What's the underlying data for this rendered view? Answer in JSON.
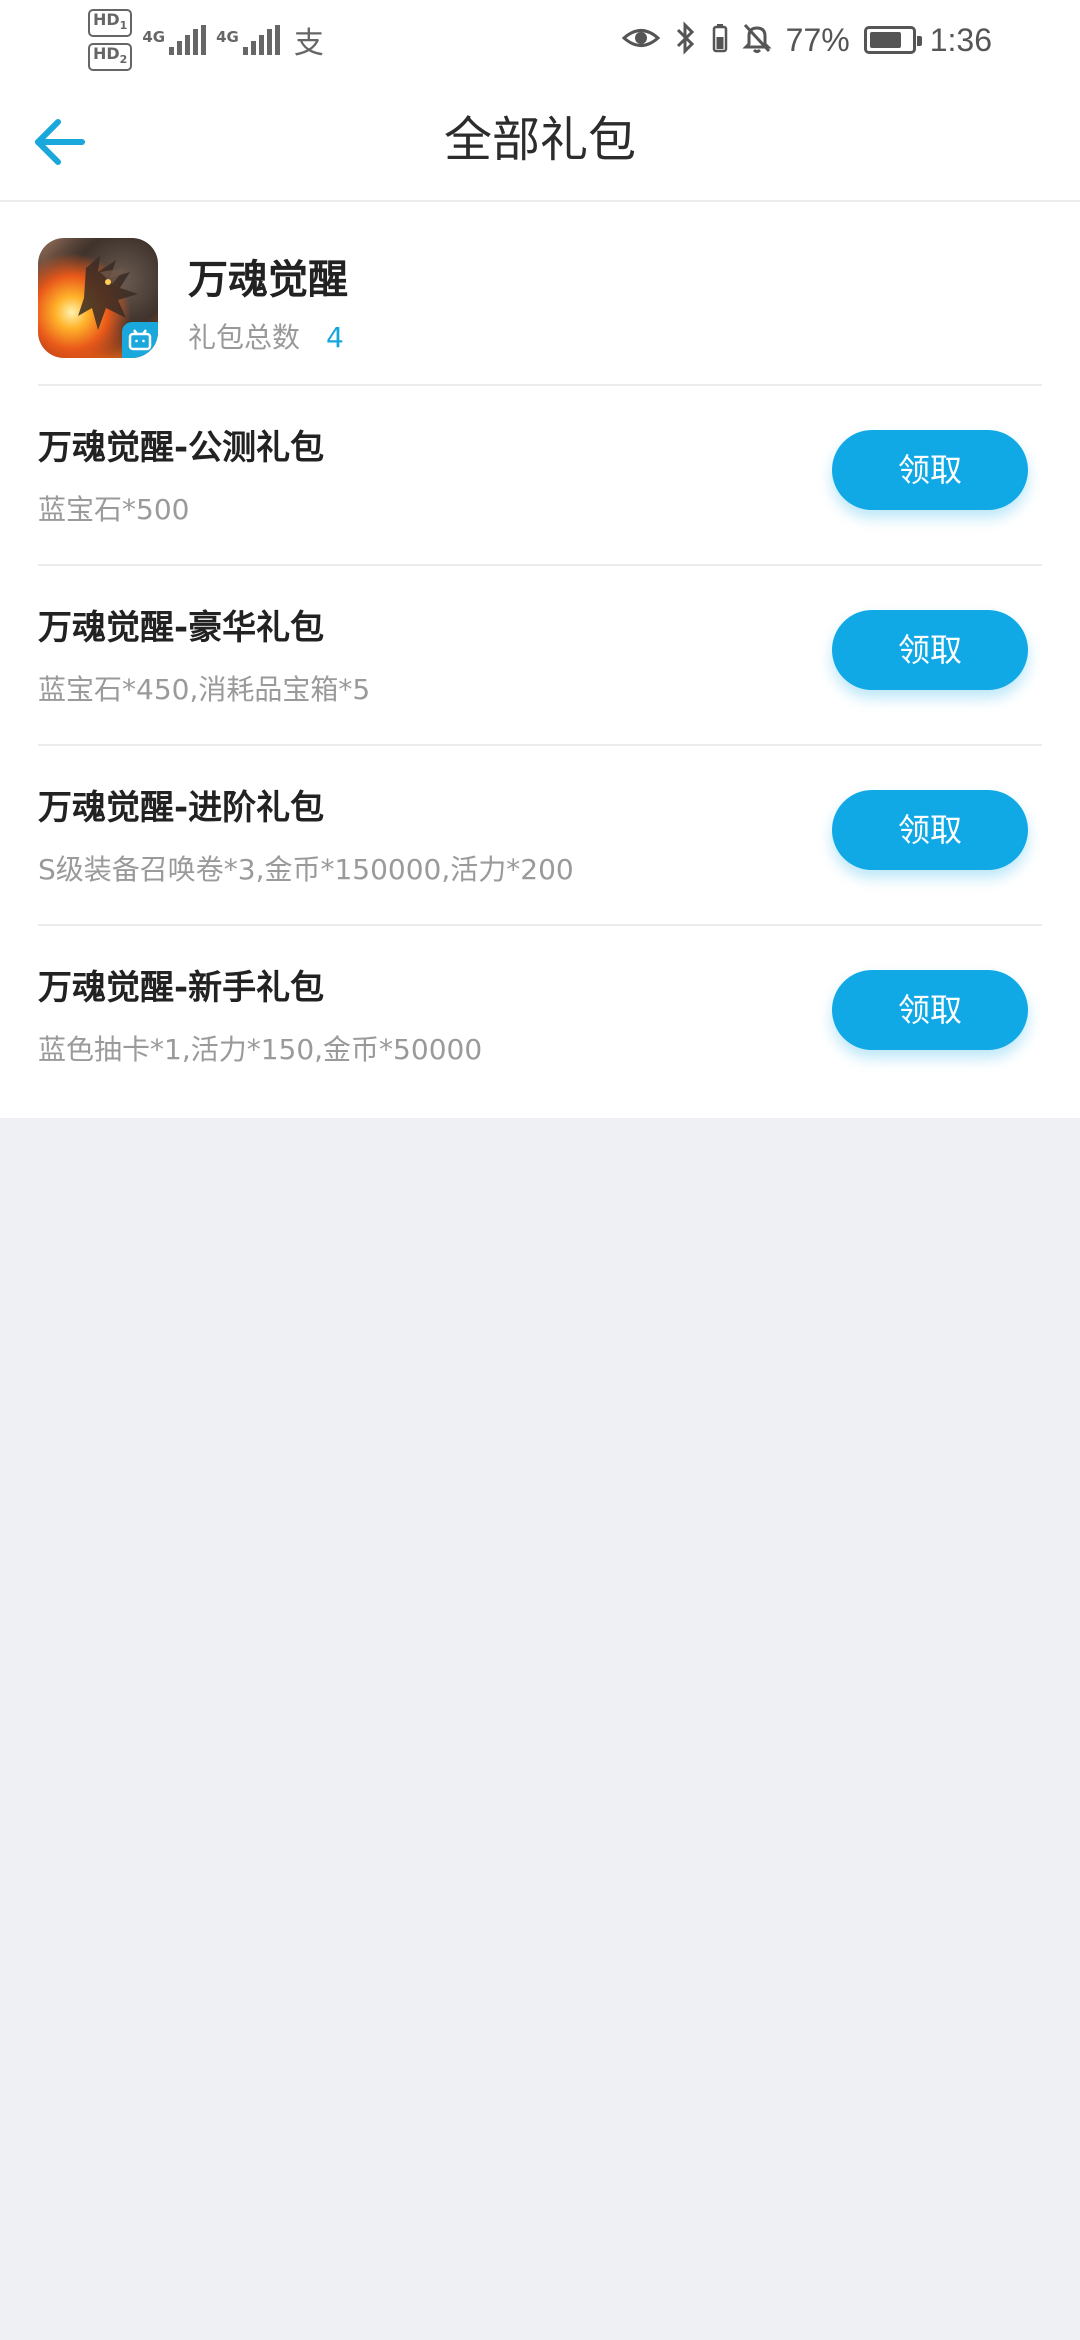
{
  "status_bar": {
    "hd1": "HD",
    "hd1_sub": "1",
    "hd2": "HD",
    "hd2_sub": "2",
    "net1": "4G",
    "net2": "4G",
    "alipay_glyph": "支",
    "battery_percent": "77%",
    "battery_level": 0.77,
    "time": "1:36",
    "icons": [
      "eye-icon",
      "bluetooth-icon",
      "bell-off-icon",
      "battery-icon"
    ]
  },
  "header": {
    "title": "全部礼包",
    "back_icon": "arrow-left-icon"
  },
  "game": {
    "name": "万魂觉醒",
    "gift_total_label": "礼包总数",
    "gift_total_count": "4"
  },
  "gifts": [
    {
      "title": "万魂觉醒-公测礼包",
      "desc": "蓝宝石*500",
      "button": "领取"
    },
    {
      "title": "万魂觉醒-豪华礼包",
      "desc": "蓝宝石*450,消耗品宝箱*5",
      "button": "领取"
    },
    {
      "title": "万魂觉醒-进阶礼包",
      "desc": "S级装备召唤卷*3,金币*150000,活力*200",
      "button": "领取"
    },
    {
      "title": "万魂觉醒-新手礼包",
      "desc": "蓝色抽卡*1,活力*150,金币*50000",
      "button": "领取"
    }
  ],
  "colors": {
    "accent": "#10a9e6",
    "background": "#eff0f3",
    "count": "#17a6dc"
  }
}
